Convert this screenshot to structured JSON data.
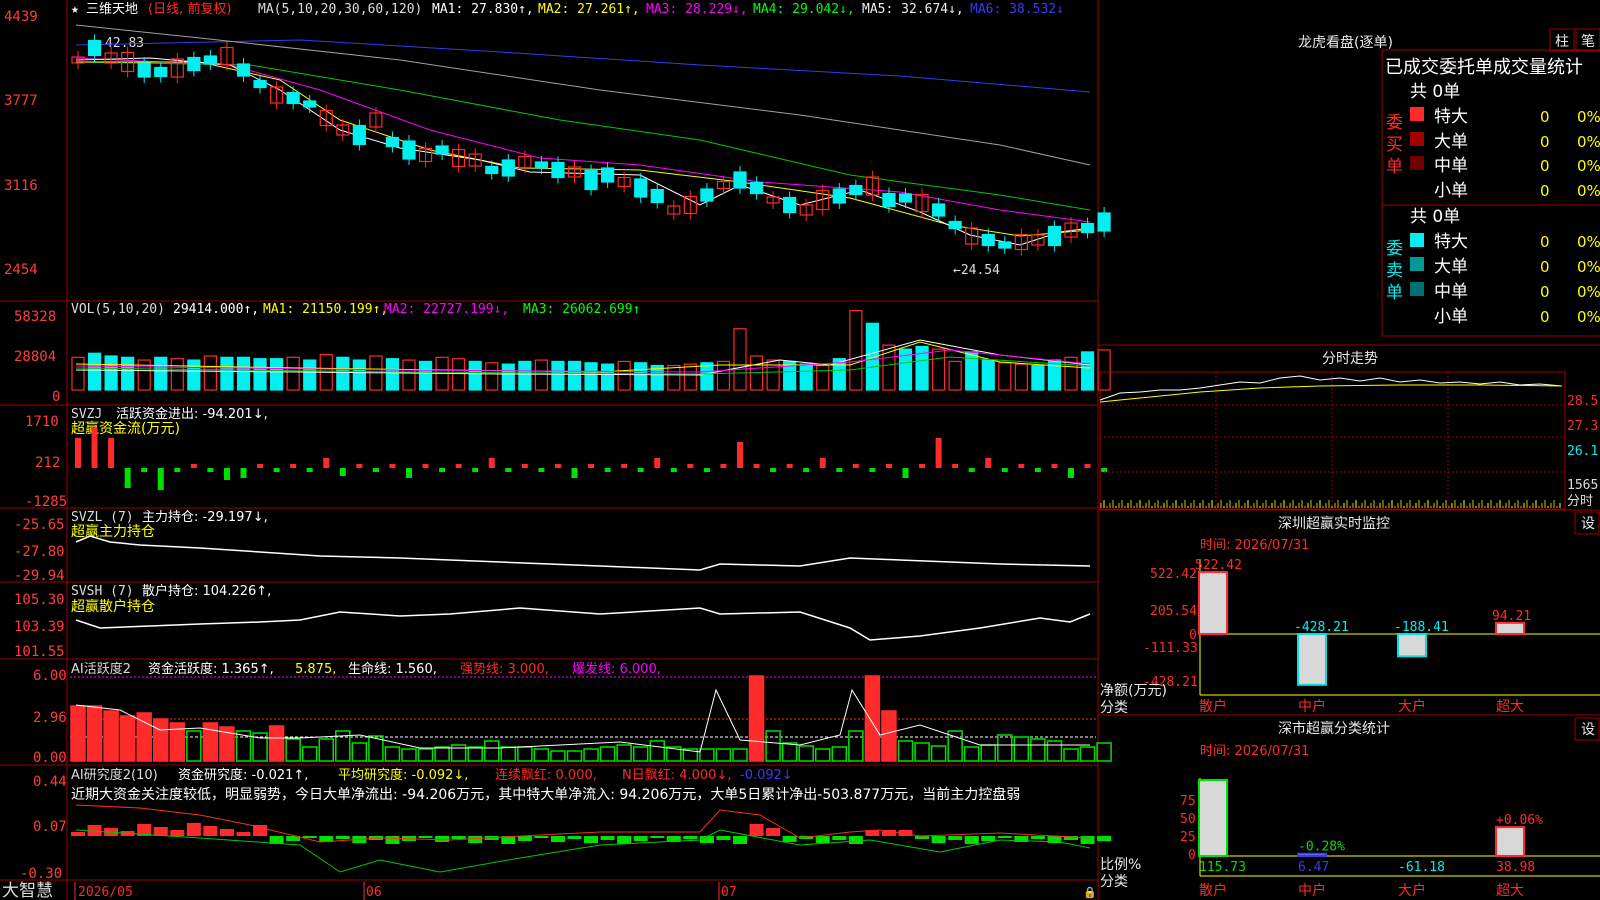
{
  "colors": {
    "up": "#ff2a2a",
    "down": "#00f0f0",
    "green": "#00e000",
    "grid": "#9a0000",
    "white": "#ffffff",
    "yellow": "#ffff00",
    "magenta": "#ff00ff",
    "green_line": "#00c800",
    "blue": "#3a3af0",
    "grey": "#a0a0a0"
  },
  "header": {
    "star": "★",
    "stock_name": "三维天地",
    "period": "(日线, 前复权)",
    "ma_params": "MA(5,10,20,30,60,120)",
    "ma1": "MA1: 27.830↑,",
    "ma2": "MA2: 27.261↑,",
    "ma3": "MA3: 28.229↓,",
    "ma4": "MA4: 29.042↓,",
    "ma5": "MA5: 32.674↓,",
    "ma6": "MA6: 38.532↓"
  },
  "price_axis": [
    "4439",
    "3777",
    "3116",
    "2454"
  ],
  "price_high_label": "42.83",
  "price_low_label": "←24.54",
  "vol": {
    "axis": [
      "58328",
      "28804",
      "0"
    ],
    "title": "VOL(5,10,20)",
    "value": "29414.000↑,",
    "ma1": "MA1: 21150.199↑,",
    "ma2": "MA2: 22727.199↓,",
    "ma3": "MA3: 26062.699↑"
  },
  "svzj": {
    "axis": [
      "1710",
      "212",
      "-1285"
    ],
    "title": "SVZJ",
    "desc": "活跃资金进出: -94.201↓,",
    "sub": "超赢资金流(万元)"
  },
  "svzl": {
    "axis": [
      "-25.65",
      "-27.80",
      "-29.94"
    ],
    "title": "SVZL (7)",
    "desc": "主力持仓: -29.197↓,",
    "sub": "超赢主力持仓"
  },
  "svsh": {
    "axis": [
      "105.30",
      "103.39",
      "101.55"
    ],
    "title": "SVSH (7)",
    "desc": "散户持仓: 104.226↑,",
    "sub": "超赢散户持仓"
  },
  "ai1": {
    "axis": [
      "6.00",
      "2.96",
      "0.00"
    ],
    "title": "AI活跃度2",
    "a": "资金活跃度: 1.365↑,",
    "b": "5.875,",
    "c": "生命线: 1.560,",
    "d": "强势线: 3.000,",
    "e": "爆发线: 6.000,"
  },
  "ai2": {
    "axis": [
      "0.44",
      "0.07",
      "-0.30"
    ],
    "title": "AI研究度2(10)",
    "a": "资金研究度: -0.021↑,",
    "b": "平均研究度: -0.092↓,",
    "c": "连续飘红: 0.000,",
    "d": "N日飘红: 4.000↓,",
    "e": "-0.092↓",
    "comment": "近期大资金关注度较低，明显弱势，今日大单净流出: -94.206万元，其中特大单净流入: 94.206万元，大单5日累计净出-503.877万元，当前主力控盘弱"
  },
  "bottom": {
    "brand": "大智慧",
    "d1": "2026/05",
    "d2": "06",
    "d3": "07"
  },
  "lhb": {
    "title": "龙虎看盘(逐单)",
    "btn1": "柱",
    "btn2": "笔",
    "tab": "已成交委托单成交量统计",
    "buy_label": [
      "委",
      "买",
      "单"
    ],
    "sell_label": [
      "委",
      "卖",
      "单"
    ],
    "count": "共 0单",
    "rows": [
      {
        "name": "特大",
        "v": "0",
        "p": "0%"
      },
      {
        "name": "大单",
        "v": "0",
        "p": "0%"
      },
      {
        "name": "中单",
        "v": "0",
        "p": "0%"
      },
      {
        "name": "小单",
        "v": "0",
        "p": "0%"
      }
    ]
  },
  "fenshi": {
    "title": "分时走势",
    "axis": [
      "28.5",
      "27.3",
      "26.1"
    ],
    "vol": "1565",
    "unit": "分时"
  },
  "monitor": {
    "title": "深圳超赢实时监控",
    "btn": "设",
    "time": "时间: 2026/07/31",
    "axis": [
      "522.42",
      "205.54",
      "0",
      "-111.33",
      "-428.21"
    ],
    "ylabel": "净额(万元)",
    "xlabel": "分类",
    "bars": [
      {
        "cat": "散户",
        "label": "522.42",
        "value": 522.42
      },
      {
        "cat": "中户",
        "label": "-428.21",
        "value": -428.21
      },
      {
        "cat": "大户",
        "label": "-188.41",
        "value": -188.41
      },
      {
        "cat": "超大",
        "label": "94.21",
        "value": 94.21
      }
    ]
  },
  "classify": {
    "title": "深市超赢分类统计",
    "btn": "设",
    "time": "时间: 2026/07/31",
    "axis": [
      "75",
      "50",
      "25",
      "0"
    ],
    "ylabel": "比例%",
    "xlabel": "分类",
    "bars": [
      {
        "cat": "散户",
        "top": "",
        "bottom": "115.73",
        "value": 100
      },
      {
        "cat": "中户",
        "top": "-0.28%",
        "bottom": "6.47",
        "value": 3
      },
      {
        "cat": "大户",
        "top": "",
        "bottom": "-61.18",
        "value": 0
      },
      {
        "cat": "超大",
        "top": "+0.06%",
        "bottom": "38.98",
        "value": 38
      }
    ]
  },
  "chart_data": {
    "type": "bar",
    "series": [
      {
        "name": "VOL",
        "values": [
          24000,
          27000,
          25000,
          24000,
          22000,
          24000,
          23000,
          22000,
          25000,
          24000,
          24000,
          23000,
          23000,
          24000,
          22000,
          26000,
          24000,
          22000,
          25000,
          23000,
          22000,
          21000,
          24000,
          23000,
          21000,
          20000,
          19000,
          21000,
          22000,
          21000,
          21000,
          20000,
          19000,
          21000,
          20000,
          18000,
          18000,
          19000,
          20000,
          21000,
          45000,
          25000,
          22000,
          21000,
          19000,
          18000,
          23000,
          58328,
          49000,
          33000,
          30000,
          32000,
          30000,
          21000,
          28000,
          22000,
          20000,
          19000,
          18000,
          22000,
          24000,
          28000,
          29414
        ]
      }
    ]
  }
}
